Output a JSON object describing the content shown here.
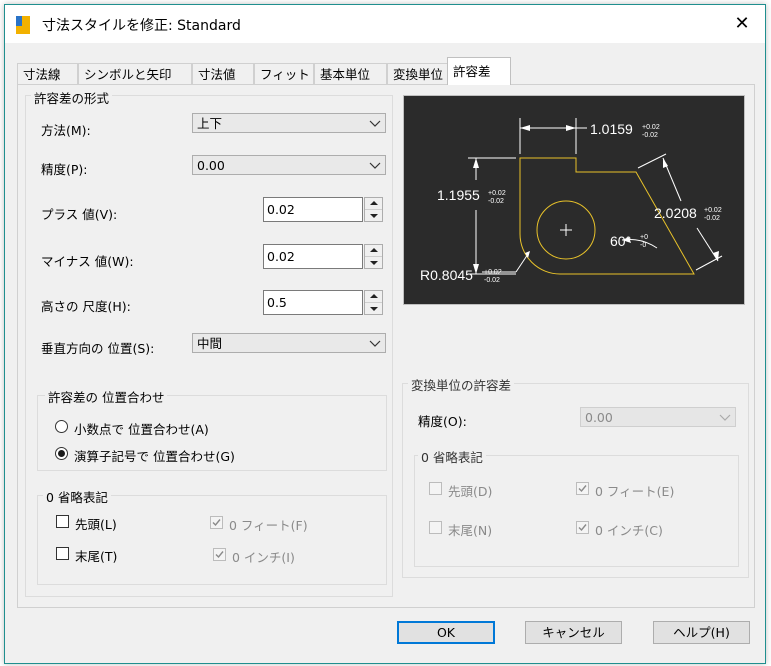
{
  "window": {
    "title": "寸法スタイルを修正: Standard",
    "close_symbol": "✕"
  },
  "tabs": [
    {
      "label": "寸法線"
    },
    {
      "label": "シンボルと矢印"
    },
    {
      "label": "寸法値"
    },
    {
      "label": "フィット"
    },
    {
      "label": "基本単位"
    },
    {
      "label": "変換単位"
    },
    {
      "label": "許容差",
      "active": true
    }
  ],
  "format": {
    "group_label": "許容差の形式",
    "method_label": "方法(M):",
    "method_value": "上下",
    "precision_label": "精度(P):",
    "precision_value": "0.00",
    "plus_label": "プラス 値(V):",
    "plus_value": "0.02",
    "minus_label": "マイナス 値(W):",
    "minus_value": "0.02",
    "height_label": "高さの 尺度(H):",
    "height_value": "0.5",
    "vpos_label": "垂直方向の 位置(S):",
    "vpos_value": "中間"
  },
  "alignment": {
    "group_label": "許容差の 位置合わせ",
    "opt1_label": "小数点で 位置合わせ(A)",
    "opt2_label": "演算子記号で 位置合わせ(G)",
    "selected": "opt2"
  },
  "zero_suppression": {
    "group_label": "0 省略表記",
    "leading_label": "先頭(L)",
    "leading_checked": false,
    "trailing_label": "末尾(T)",
    "trailing_checked": false,
    "feet_label": "0 フィート(F)",
    "feet_checked": true,
    "inches_label": "0 インチ(I)",
    "inches_checked": true
  },
  "preview": {
    "dim_top": "1.0159",
    "tol_top_upper": "+0.02",
    "tol_top_lower": "-0.02",
    "dim_left": "1.1955",
    "tol_left_upper": "+0.02",
    "tol_left_lower": "-0.02",
    "dim_diag": "2.0208",
    "tol_diag_upper": "+0.02",
    "tol_diag_lower": "-0.02",
    "dim_angle": "60°",
    "tol_angle_upper": "+0",
    "tol_angle_lower": "-0",
    "dim_radius": "R0.8045",
    "tol_radius_upper": "+0.02",
    "tol_radius_lower": "-0.02",
    "line_color": "#ffffff",
    "geometry_color": "#e8c22a",
    "background": "#2b2b2b"
  },
  "alt_units": {
    "group_label": "変換単位の許容差",
    "precision_label": "精度(O):",
    "precision_value": "0.00",
    "zero_group_label": "0 省略表記",
    "leading_label": "先頭(D)",
    "leading_checked": false,
    "trailing_label": "末尾(N)",
    "trailing_checked": false,
    "feet_label": "0 フィート(E)",
    "feet_checked": true,
    "inches_label": "0 インチ(C)",
    "inches_checked": true
  },
  "buttons": {
    "ok": "OK",
    "cancel": "キャンセル",
    "help": "ヘルプ(H)"
  },
  "accent_color": "#0078d7"
}
